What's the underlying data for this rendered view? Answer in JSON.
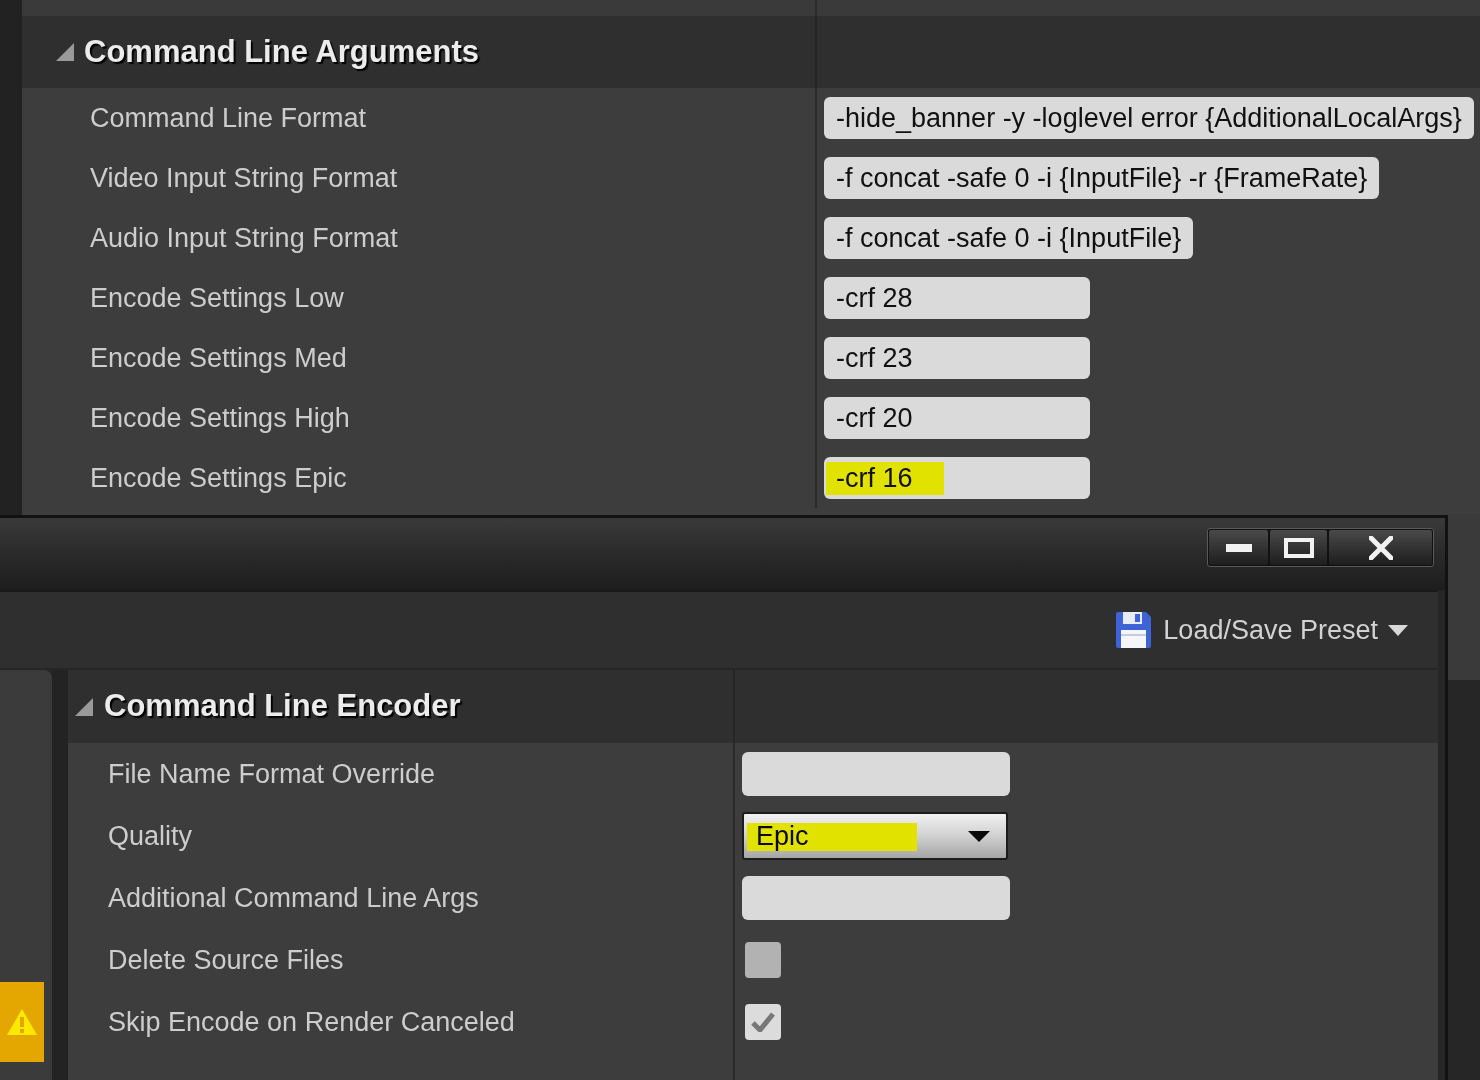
{
  "arguments_panel": {
    "title": "Command Line Arguments",
    "expanded": true,
    "rows": [
      {
        "label": "Command Line Format",
        "value": "-hide_banner -y -loglevel error {AdditionalLocalArgs}",
        "highlighted": false
      },
      {
        "label": "Video Input String Format",
        "value": "-f concat -safe 0 -i {InputFile} -r {FrameRate}",
        "highlighted": false
      },
      {
        "label": "Audio Input String Format",
        "value": "-f concat -safe 0 -i {InputFile}",
        "highlighted": false
      },
      {
        "label": "Encode Settings Low",
        "value": "-crf 28",
        "highlighted": false
      },
      {
        "label": "Encode Settings Med",
        "value": "-crf 23",
        "highlighted": false
      },
      {
        "label": "Encode Settings High",
        "value": "-crf 20",
        "highlighted": false
      },
      {
        "label": "Encode Settings Epic",
        "value": "-crf 16",
        "highlighted": true
      }
    ]
  },
  "encoder_window": {
    "toolbar": {
      "preset_button": "Load/Save Preset"
    },
    "section": {
      "title": "Command Line Encoder",
      "expanded": true,
      "rows": [
        {
          "kind": "text",
          "label": "File Name Format Override",
          "highlighted": false
        },
        {
          "kind": "dropdown",
          "label": "Quality",
          "value": "Epic",
          "highlighted": true
        },
        {
          "kind": "text",
          "label": "Additional Command Line Args",
          "highlighted": false
        },
        {
          "kind": "checkbox",
          "label": "Delete Source Files",
          "checked": false,
          "highlighted": false
        },
        {
          "kind": "checkbox",
          "label": "Skip Encode on Render Canceled",
          "checked": true,
          "highlighted": false
        }
      ]
    }
  }
}
